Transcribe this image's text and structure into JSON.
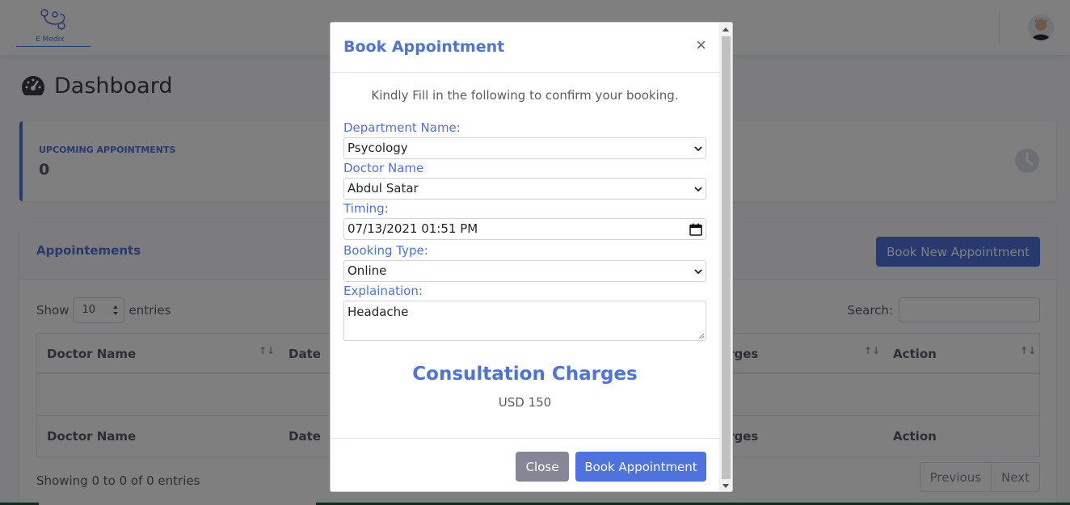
{
  "brand": {
    "logo_text": "E Medix"
  },
  "page": {
    "title": "Dashboard"
  },
  "stats": {
    "upcoming_label": "UPCOMING APPOINTMENTS",
    "upcoming_value": "0"
  },
  "appointments": {
    "header": "Appointements",
    "new_button": "Book New Appointment",
    "show_label": "Show",
    "entries_value": "10",
    "entries_label": "entries",
    "search_label": "Search:",
    "columns": [
      "Doctor Name",
      "Date",
      "arges",
      "Action"
    ],
    "showing_text": "Showing 0 to 0 of 0 entries",
    "prev_label": "Previous",
    "next_label": "Next"
  },
  "modal": {
    "title": "Book Appointment",
    "close_glyph": "×",
    "intro": "Kindly Fill in the following to confirm your booking.",
    "department_label": "Department Name:",
    "department_value": "Psycology",
    "doctor_label": "Doctor Name",
    "doctor_value": "Abdul Satar",
    "timing_label": "Timing:",
    "timing_value": "07/13/2021 01:51 PM",
    "booking_type_label": "Booking Type:",
    "booking_type_value": "Online",
    "explanation_label": "Explaination:",
    "explanation_value": "Headache",
    "charges_title": "Consultation Charges",
    "charges_value": "USD 150",
    "close_button": "Close",
    "book_button": "Book Appointment"
  },
  "colors": {
    "primary": "#4e73df",
    "secondary": "#858796"
  }
}
